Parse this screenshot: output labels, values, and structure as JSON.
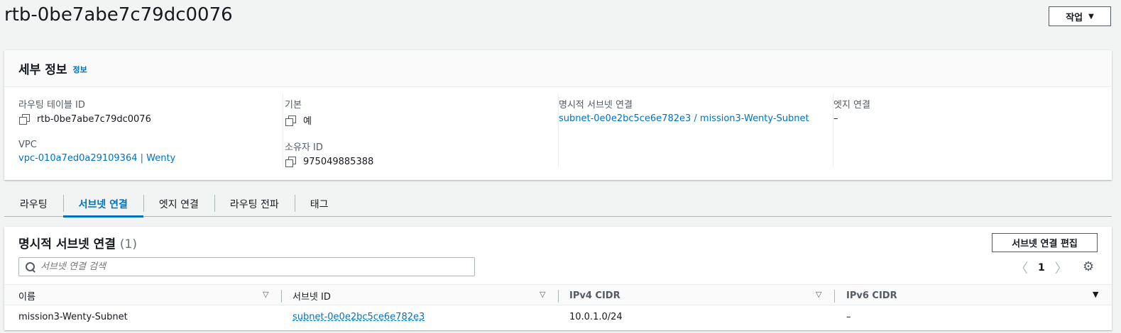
{
  "header": {
    "title": "rtb-0be7abe7c79dc0076",
    "actions_label": "작업"
  },
  "details": {
    "title": "세부 정보",
    "info_link": "정보",
    "fields": {
      "route_table_id": {
        "label": "라우팅 테이블 ID",
        "value": "rtb-0be7abe7c79dc0076"
      },
      "vpc": {
        "label": "VPC",
        "value": "vpc-010a7ed0a29109364 | Wenty"
      },
      "main": {
        "label": "기본",
        "value": "예"
      },
      "owner_id": {
        "label": "소유자 ID",
        "value": "975049885388"
      },
      "explicit_subnet": {
        "label": "명시적 서브넷 연결",
        "value": "subnet-0e0e2bc5ce6e782e3 / mission3-Wenty-Subnet"
      },
      "edge": {
        "label": "엣지 연결",
        "value": "–"
      }
    }
  },
  "tabs": [
    "라우팅",
    "서브넷 연결",
    "엣지 연결",
    "라우팅 전파",
    "태그"
  ],
  "active_tab": "서브넷 연결",
  "subnet_table": {
    "title": "명시적 서브넷 연결",
    "count": "(1)",
    "edit_button": "서브넷 연결 편집",
    "search_placeholder": "서브넷 연결 검색",
    "page": "1",
    "columns": [
      "이름",
      "서브넷 ID",
      "IPv4 CIDR",
      "IPv6 CIDR"
    ],
    "rows": [
      {
        "name": "mission3-Wenty-Subnet",
        "subnet_id": "subnet-0e0e2bc5ce6e782e3",
        "ipv4": "10.0.1.0/24",
        "ipv6": "–"
      }
    ]
  },
  "colors": {
    "link": "#0073bb",
    "text": "#16191f",
    "background": "#f2f3f3"
  }
}
